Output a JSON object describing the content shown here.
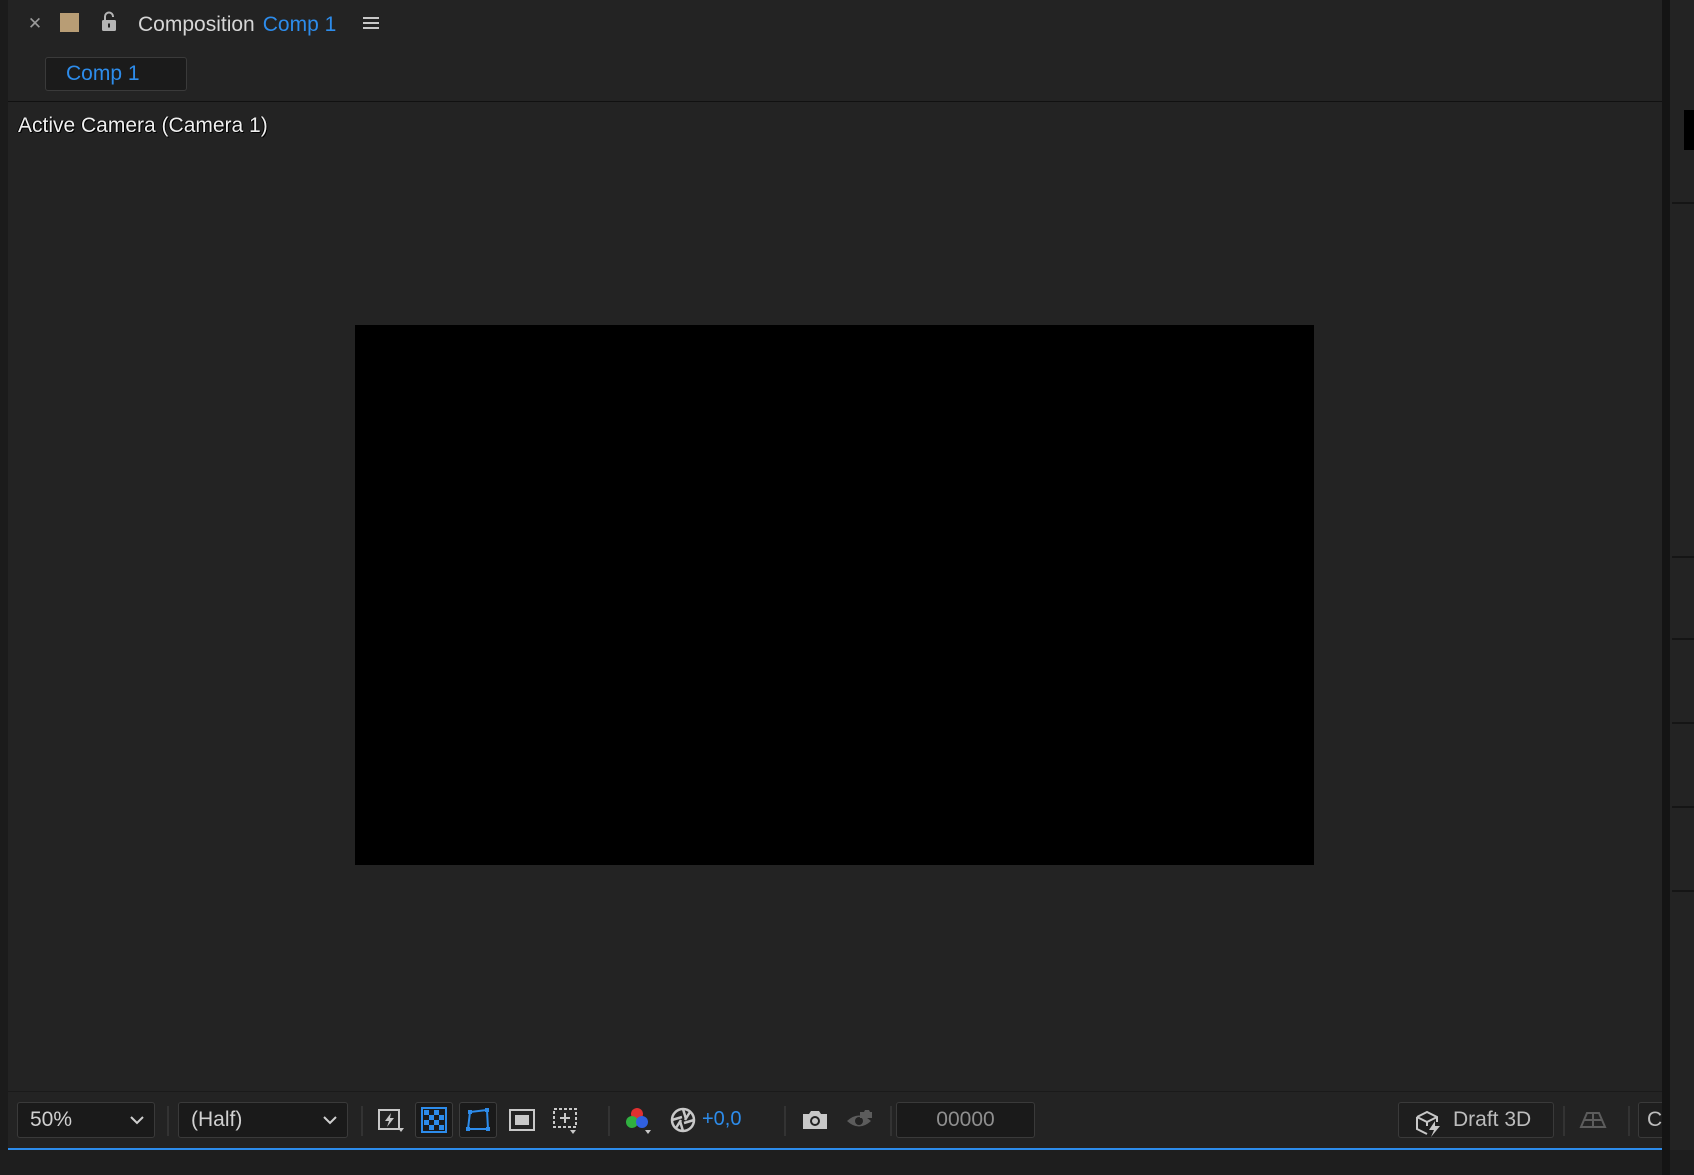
{
  "header": {
    "panel_label": "Composition",
    "comp_name": "Comp 1",
    "swatch_color": "#b89d75",
    "accent_color": "#2d8ceb"
  },
  "tabs": [
    {
      "label": "Comp 1",
      "active": true
    }
  ],
  "viewer": {
    "camera_label": "Active Camera (Camera 1)"
  },
  "toolbar": {
    "magnification": "50%",
    "resolution": "(Half)",
    "exposure": "+0,0",
    "timecode": "00000",
    "renderer": "Draft 3D",
    "truncated_button": "C",
    "icons": [
      "fast-previews-icon",
      "transparency-grid-icon",
      "mask-path-visibility-icon",
      "region-of-interest-icon",
      "grid-guides-icon",
      "channels-icon",
      "exposure-reset-icon",
      "snapshot-icon",
      "show-snapshot-icon",
      "draft-3d-icon",
      "3d-ground-plane-icon"
    ]
  }
}
